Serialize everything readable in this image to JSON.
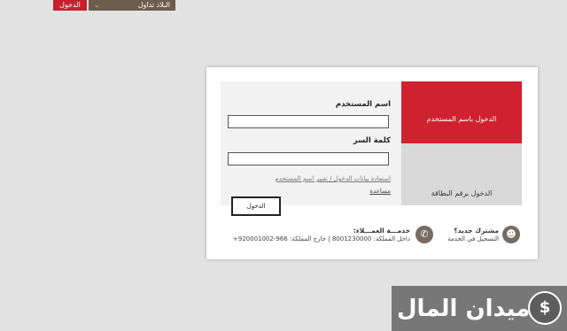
{
  "topbar": {
    "login_label": "الدخول",
    "dropdown_label": "البلاد تداول",
    "accent_color": "#c8202f"
  },
  "tabs": {
    "username_login": "الدخول باسم المستخدم",
    "card_login": "الدخول برقم البطاقة"
  },
  "form": {
    "username_label": "اسم المستخدم",
    "password_label": "كلمة السر",
    "username_value": "",
    "password_value": "",
    "recover_link": "استعادة بيانات الدخول / تغيير اسم المستخدم",
    "help_link": "مساعدة",
    "submit_label": "الدخول"
  },
  "footer": {
    "new_user_title": "مشترك جديد؟",
    "new_user_text": "التسجيل في الخدمة",
    "service_title": "خدمـــة العمـــلاء:",
    "service_phones": "داخل المملكة: 8001230000 | خارج المملكة: 966-920001002+",
    "new_user_icon": "user-add-icon",
    "phone_icon": "phone-icon"
  },
  "brand": {
    "text": "ميدان المال",
    "logo_icon": "wallet-logo-icon"
  }
}
